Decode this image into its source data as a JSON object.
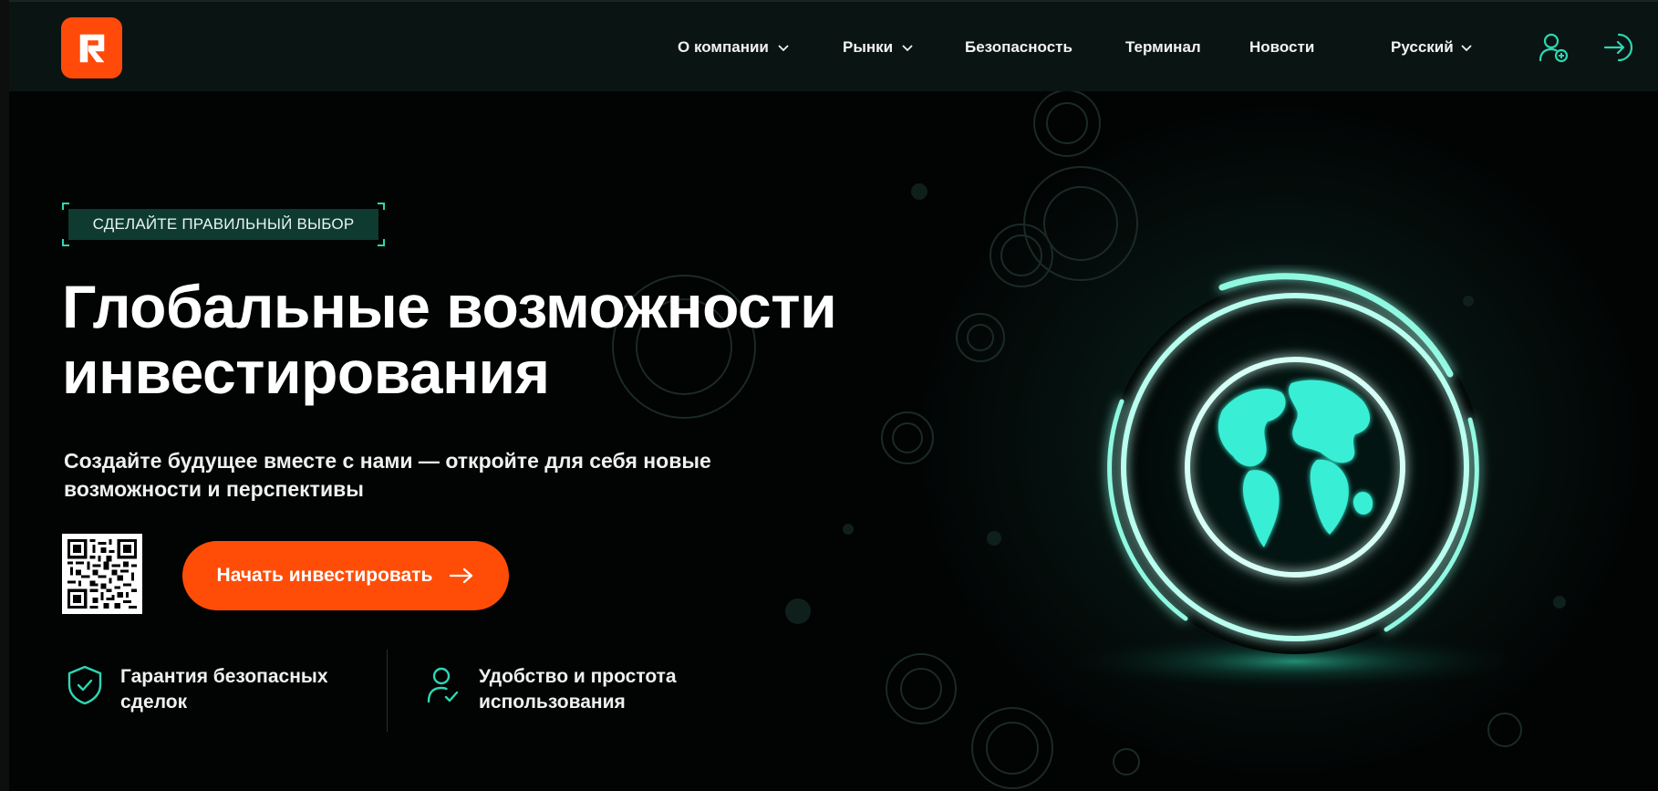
{
  "header": {
    "logo_glyph": "Я",
    "nav": [
      {
        "label": "О компании",
        "has_dropdown": true
      },
      {
        "label": "Рынки",
        "has_dropdown": true
      },
      {
        "label": "Безопасность",
        "has_dropdown": false
      },
      {
        "label": "Терминал",
        "has_dropdown": false
      },
      {
        "label": "Новости",
        "has_dropdown": false
      }
    ],
    "language": "Русский",
    "icons": [
      "user-add-icon",
      "login-icon"
    ]
  },
  "hero": {
    "badge": "СДЕЛАЙТЕ ПРАВИЛЬНЫЙ ВЫБОР",
    "title_line1": "Глобальные возможности",
    "title_line2": "инвестирования",
    "subtitle_line1": "Создайте будущее вместе с нами — откройте для себя новые",
    "subtitle_line2": "возможности и перспективы",
    "cta_label": "Начать инвестировать",
    "features": [
      {
        "icon": "shield-check-icon",
        "line1": "Гарантия безопасных",
        "line2": "сделок"
      },
      {
        "icon": "user-check-icon",
        "line1": "Удобство и простота",
        "line2": "использования"
      }
    ]
  },
  "colors": {
    "accent": "#ff4d08",
    "teal": "#2fd6b2",
    "header_bg": "#0a1513",
    "page_bg": "#020303"
  }
}
